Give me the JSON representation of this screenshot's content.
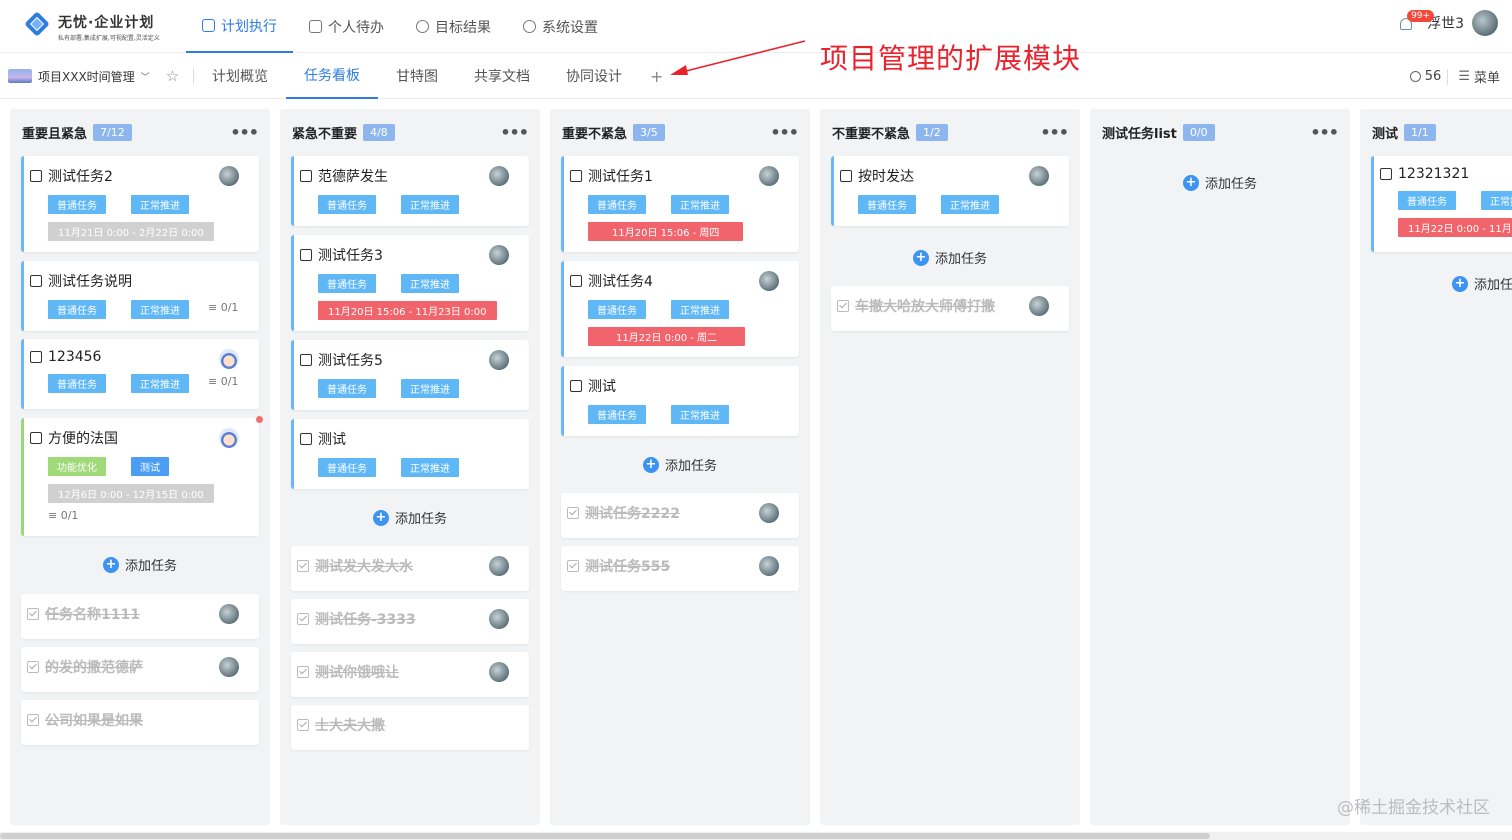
{
  "app": {
    "name": "无忧·企业计划",
    "tagline": "私有部署,集成扩展,可视配置,灵活定义"
  },
  "main_nav": [
    {
      "label": "计划执行",
      "icon": "doc-icon",
      "active": true
    },
    {
      "label": "个人待办",
      "icon": "calendar-icon",
      "active": false
    },
    {
      "label": "目标结果",
      "icon": "target-icon",
      "active": false
    },
    {
      "label": "系统设置",
      "icon": "gear-icon",
      "active": false
    }
  ],
  "user": {
    "notifications": "99+",
    "name": "浮世3"
  },
  "project": {
    "name": "项目XXX时间管理"
  },
  "sub_tabs": [
    {
      "label": "计划概览",
      "active": false
    },
    {
      "label": "任务看板",
      "active": true
    },
    {
      "label": "甘特图",
      "active": false
    },
    {
      "label": "共享文档",
      "active": false
    },
    {
      "label": "协同设计",
      "active": false
    }
  ],
  "sub_tab_add": "+",
  "sub_right": {
    "members": "56",
    "menu_label": "菜单"
  },
  "annotation": {
    "text": "项目管理的扩展模块",
    "color": "#e8232e"
  },
  "colors": {
    "accent": "#2f7de1",
    "tag_type": "#5fb8f5",
    "date_overdue": "#f2646b"
  },
  "add_task_label": "添加任务",
  "columns": [
    {
      "title": "重要且紧急",
      "count": "7/12",
      "cards": [
        {
          "title": "测试任务2",
          "tags": [
            "普通任务",
            "正常推进"
          ],
          "date": "11月21日 0:00 - 2月22日 0:00",
          "date_style": "gray"
        },
        {
          "title": "测试任务说明",
          "tags": [
            "普通任务",
            "正常推进"
          ],
          "subtasks": "≡ 0/1"
        },
        {
          "title": "123456",
          "tags": [
            "普通任务",
            "正常推进"
          ],
          "subtasks": "≡ 0/1",
          "avatar": "cartoon"
        },
        {
          "title": "方便的法国",
          "tags": [
            "功能优化",
            "测试"
          ],
          "date": "12月6日 0:00 - 12月15日 0:00",
          "date_style": "gray",
          "subtasks_line": "≡ 0/1",
          "avatar": "cartoon",
          "accent": "green"
        }
      ],
      "done": [
        "任务名称1111",
        "的发的撒范德萨",
        "公司如果是如果"
      ]
    },
    {
      "title": "紧急不重要",
      "count": "4/8",
      "cards": [
        {
          "title": "范德萨发生",
          "tags": [
            "普通任务",
            "正常推进"
          ]
        },
        {
          "title": "测试任务3",
          "tags": [
            "普通任务",
            "正常推进"
          ],
          "date": "11月20日 15:06 - 11月23日 0:00",
          "date_style": "red"
        },
        {
          "title": "测试任务5",
          "tags": [
            "普通任务",
            "正常推进"
          ]
        },
        {
          "title": "测试",
          "tags": [
            "普通任务",
            "正常推进"
          ]
        }
      ],
      "done": [
        "测试发大发大水",
        "测试任务-3333",
        "测试你饿哦让",
        "士大夫大撒"
      ]
    },
    {
      "title": "重要不紧急",
      "count": "3/5",
      "cards": [
        {
          "title": "测试任务1",
          "tags": [
            "普通任务",
            "正常推进"
          ],
          "date": "11月20日 15:06 - 周四",
          "date_style": "red"
        },
        {
          "title": "测试任务4",
          "tags": [
            "普通任务",
            "正常推进"
          ],
          "date": "11月22日 0:00 - 周二",
          "date_style": "red"
        },
        {
          "title": "测试",
          "tags": [
            "普通任务",
            "正常推进"
          ]
        }
      ],
      "done": [
        "测试任务2222",
        "测试任务555"
      ]
    },
    {
      "title": "不重要不紧急",
      "count": "1/2",
      "cards": [
        {
          "title": "按时发达",
          "tags": [
            "普通任务",
            "正常推进"
          ]
        }
      ],
      "done": [
        "车撤大哈放大师傅打撒"
      ]
    },
    {
      "title": "测试任务list",
      "count": "0/0",
      "cards": [],
      "done": []
    },
    {
      "title": "测试",
      "count": "1/1",
      "cards": [
        {
          "title": "12321321",
          "tags": [
            "普通任务",
            "正常推进"
          ],
          "date": "11月22日 0:00 - 11月",
          "date_style": "red"
        }
      ],
      "done": []
    }
  ],
  "watermark": "@稀土掘金技术社区"
}
